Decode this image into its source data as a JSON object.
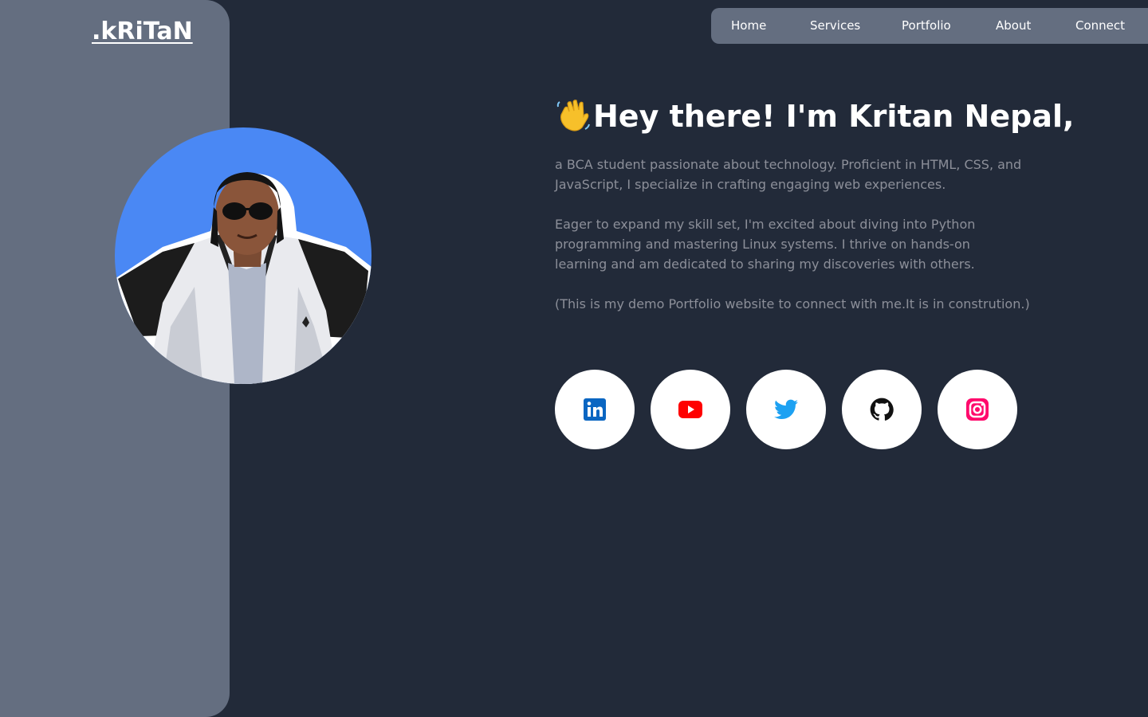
{
  "brand": {
    "logo": ".kRiTaN"
  },
  "nav": {
    "items": [
      {
        "label": "Home"
      },
      {
        "label": "Services"
      },
      {
        "label": "Portfolio"
      },
      {
        "label": "About"
      },
      {
        "label": "Connect"
      }
    ]
  },
  "hero": {
    "wave_icon": "waving-hand-emoji",
    "headline": "Hey there! I'm Kritan Nepal,",
    "paragraphs": [
      "a BCA student passionate about technology. Proficient in HTML, CSS, and JavaScript, I specialize in crafting engaging web experiences.",
      "Eager to expand my skill set, I'm excited about diving into Python programming and mastering Linux systems. I thrive on hands-on learning and am dedicated to sharing my discoveries with others.",
      "(This is my demo Portfolio website to connect with me.It is in constrution.)"
    ]
  },
  "socials": [
    {
      "icon": "linkedin-icon",
      "color": "#0a66c2"
    },
    {
      "icon": "youtube-icon",
      "color": "#ff0000"
    },
    {
      "icon": "twitter-icon",
      "color": "#1da1f2"
    },
    {
      "icon": "github-icon",
      "color": "#111111"
    },
    {
      "icon": "instagram-icon",
      "color": "#ff0a6c"
    }
  ],
  "colors": {
    "background": "#222a39",
    "panel": "#646e80",
    "avatar_bg": "#4a88f4",
    "body_text": "#8c8f99"
  }
}
